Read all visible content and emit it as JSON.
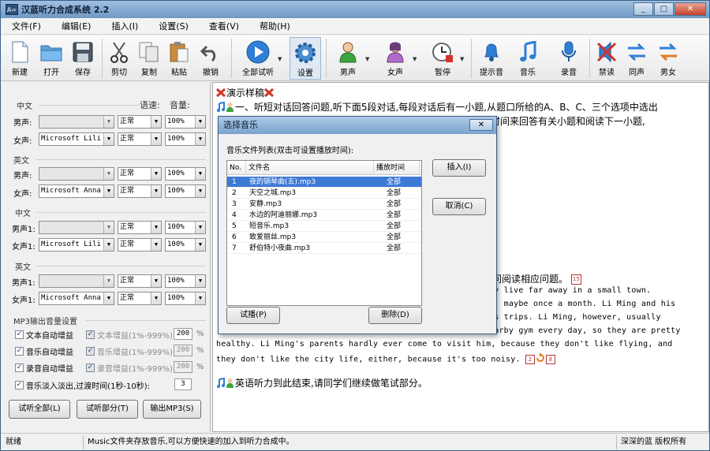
{
  "window": {
    "icon_text": "A=",
    "title": "汉蓝听力合成系统 2.2",
    "min": "_",
    "max": "□",
    "close": "✕"
  },
  "menu": [
    "文件(F)",
    "编辑(E)",
    "插入(I)",
    "设置(S)",
    "查看(V)",
    "帮助(H)"
  ],
  "toolbar": {
    "new": "新建",
    "open": "打开",
    "save": "保存",
    "cut": "剪切",
    "copy": "复制",
    "paste": "粘贴",
    "undo": "撤销",
    "preview_all": "全部试听",
    "settings": "设置",
    "male": "男声",
    "female": "女声",
    "pause": "暂停",
    "beep": "提示音",
    "music": "音乐",
    "record": "录音",
    "mute": "禁读",
    "same_voice": "同声",
    "male_female": "男女"
  },
  "left": {
    "speed_header": "语速:",
    "volume_header": "音量:",
    "groups": [
      {
        "name": "中文",
        "rows": [
          {
            "label": "男声:",
            "voice": "",
            "disabled": true,
            "speed": "正常",
            "volume": "100%"
          },
          {
            "label": "女声:",
            "voice": "Microsoft Lili",
            "disabled": false,
            "speed": "正常",
            "volume": "100%"
          }
        ]
      },
      {
        "name": "英文",
        "rows": [
          {
            "label": "男声:",
            "voice": "",
            "disabled": true,
            "speed": "正常",
            "volume": "100%"
          },
          {
            "label": "女声:",
            "voice": "Microsoft Anna",
            "disabled": false,
            "speed": "正常",
            "volume": "100%"
          }
        ]
      },
      {
        "name": "中文",
        "rows": [
          {
            "label": "男声1:",
            "voice": "",
            "disabled": true,
            "speed": "正常",
            "volume": "100%"
          },
          {
            "label": "女声1:",
            "voice": "Microsoft Lili",
            "disabled": false,
            "speed": "正常",
            "volume": "100%"
          }
        ]
      },
      {
        "name": "英文",
        "rows": [
          {
            "label": "男声1:",
            "voice": "",
            "disabled": true,
            "speed": "正常",
            "volume": "100%"
          },
          {
            "label": "女声1:",
            "voice": "Microsoft Anna",
            "disabled": false,
            "speed": "正常",
            "volume": "100%"
          }
        ]
      }
    ],
    "mp3_header": "MP3输出音量设置",
    "auto": [
      {
        "label": "文本自动增益",
        "gain_label": "文本增益(1%-999%)",
        "gain": "200",
        "unit": "%"
      },
      {
        "label": "音乐自动增益",
        "gain_label": "音乐增益(1%-999%)",
        "gain": "200",
        "unit": "%"
      },
      {
        "label": "录音自动增益",
        "gain_label": "录音增益(1%-999%)",
        "gain": "200",
        "unit": "%"
      }
    ],
    "fade_label": "音乐淡入淡出,过渡时间(1秒-10秒):",
    "fade_value": "3",
    "btn_listen_all": "试听全部(L)",
    "btn_listen_part": "试听部分(T)",
    "btn_export": "输出MP3(S)"
  },
  "editor": {
    "title": "演示样稿",
    "line1": "一、听短对话回答问题,听下面5段对话,每段对话后有一小题,从题口所给的A、B、C、三个选项中选出",
    "line2_tail": "的时间来回答有关小题和阅读下一小题,",
    "line_mid": "问阅读相应问题。",
    "line_mid_badge": "15",
    "en1": "ey live far away in a small town.",
    "en2": "n, maybe once a month.  Li Ming and his",
    "en3": "ss trips.  Li Ming, however, usually",
    "en4": "earby gym every day, so they are pretty",
    "en5": "healthy.  Li Ming's parents hardly ever come to visit him, because they don't like flying, and",
    "en6": "they don't like the city life, either, because it's too noisy.",
    "en6_badge1": "2",
    "en6_badge2": "8",
    "end_line": "英语听力到此结束,请同学们继续做笔试部分。"
  },
  "dialog": {
    "title": "选择音乐",
    "close": "✕",
    "list_label": "音乐文件列表(双击可设置播放时间):",
    "col_no": "No.",
    "col_name": "文件名",
    "col_time": "播放时间",
    "rows": [
      {
        "no": "1",
        "name": "夜的钢琴曲(五).mp3",
        "time": "全部"
      },
      {
        "no": "2",
        "name": "天空之城.mp3",
        "time": "全部"
      },
      {
        "no": "3",
        "name": "安静.mp3",
        "time": "全部"
      },
      {
        "no": "4",
        "name": "水边的阿迪丽娜.mp3",
        "time": "全部"
      },
      {
        "no": "5",
        "name": "短音乐.mp3",
        "time": "全部"
      },
      {
        "no": "6",
        "name": "致爱丽丝.mp3",
        "time": "全部"
      },
      {
        "no": "7",
        "name": "舒伯特小夜曲.mp3",
        "time": "全部"
      }
    ],
    "btn_insert": "插入(I)",
    "btn_cancel": "取消(C)",
    "btn_preview": "试播(P)",
    "btn_delete": "删除(D)"
  },
  "status": {
    "left": "就绪",
    "middle": "Music文件夹存放音乐,可以方便快速的加入到听力合成中。",
    "right": "深深的蓝 版权所有"
  },
  "colors": {
    "accent": "#3d7ad6",
    "title_bar": "#7aa3cd",
    "mute_red": "#d0342c"
  }
}
